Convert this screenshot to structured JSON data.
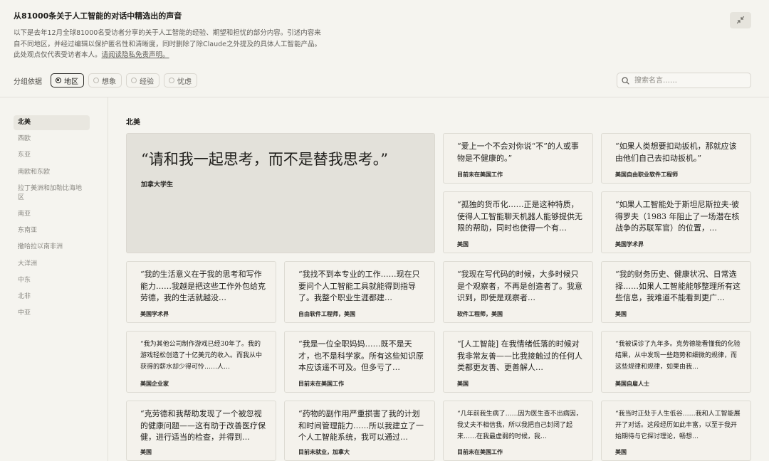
{
  "header": {
    "title": "从81000条关于人工智能的对话中精选出的声音",
    "desc_line1": "以下是去年12月全球81000名受访者分享的关于人工智能的经验、期望和担忧的部分内容。引述内容来",
    "desc_line2": "自不同地区，并经过编辑以保护匿名性和清晰度，同时删除了除Claude之外提及的具体人工智能产品。",
    "desc_line3": "此处观点仅代表受访者本人。",
    "privacy_link": "请阅读隐私免责声明。"
  },
  "grouping": {
    "label": "分组依据",
    "options": [
      "地区",
      "想象",
      "经验",
      "忧虑"
    ],
    "selected": "地区"
  },
  "search": {
    "placeholder": "搜索名言……",
    "value": ""
  },
  "sidebar": {
    "items": [
      "北美",
      "西欧",
      "东亚",
      "南欧和东欧",
      "拉丁美洲和加勒比海地区",
      "南亚",
      "东南亚",
      "撒哈拉以南非洲",
      "大洋洲",
      "中东",
      "北非",
      "中亚"
    ],
    "active": "北美"
  },
  "region_title": "北美",
  "cards": [
    {
      "quote": "“请和我一起思考，而不是替我思考。”",
      "author": "加拿大学生"
    },
    {
      "quote": "“爱上一个不会对你说“不”的人或事物是不健康的。”",
      "author": "目前未在美国工作"
    },
    {
      "quote": "“如果人类想要扣动扳机，那就应该由他们自己去扣动扳机。”",
      "author": "美国自由职业软件工程师"
    },
    {
      "quote": "“孤独的货币化……正是这种特质，使得人工智能聊天机器人能够提供无限的帮助，同时也使得一个有…",
      "author": "美国"
    },
    {
      "quote": "“如果人工智能处于斯坦尼斯拉夫·彼得罗夫（1983 年阻止了一场潜在核战争的苏联军官）的位置，…",
      "author": "美国学术界"
    },
    {
      "quote": "“我的生活意义在于我的思考和写作能力……我越是把这些工作外包给克劳德，我的生活就越没…",
      "author": "美国学术界"
    },
    {
      "quote": "“我找不到本专业的工作……现在只要问个人工智能工具就能得到指导了。我整个职业生涯都建…",
      "author": "自由软件工程师，美国"
    },
    {
      "quote": "“我现在写代码的时候，大多时候只是个观察者，不再是创造者了。我意识到，即使是观察者…",
      "author": "软件工程师，美国"
    },
    {
      "quote": "“我的财务历史、健康状况、日常选择……如果人工智能能够整理所有这些信息，我难道不能看到更广…",
      "author": "美国"
    },
    {
      "quote": "“我为其他公司制作游戏已经30年了。我的游戏轻松创造了十亿美元的收入。而我从中获得的薪水却少得可怜……人…",
      "author": "美国企业家"
    },
    {
      "quote": "“我是一位全职妈妈……既不是天才，也不是科学家。所有这些知识原本应该遥不可及。但多亏了…",
      "author": "目前未在美国工作"
    },
    {
      "quote": "“[人工智能] 在我情绪低落的时候对我非常友善——比我接触过的任何人类都更友善、更善解人…",
      "author": "美国"
    },
    {
      "quote": "“我被误诊了九年多。克劳德能看懂我的化验结果，从中发现一些趋势和细微的规律，而这些规律和规律，如果由我…",
      "author": "美国自雇人士"
    },
    {
      "quote": "“克劳德和我帮助发现了一个被忽视的健康问题——这有助于改善医疗保健，进行适当的检查，并得到…",
      "author": "美国"
    },
    {
      "quote": "“药物的副作用严重损害了我的计划和时间管理能力……所以我建立了一个人工智能系统，我可以通过…",
      "author": "目前未就业，加拿大"
    },
    {
      "quote": "“几年前我生病了……因为医生查不出病因，我丈夫不相信我，所以我把自己封闭了起来……在我最虚弱的时候，我…",
      "author": "目前未在美国工作"
    },
    {
      "quote": "“我当时正处于人生低谷……我和人工智能展开了对话。这段经历如此丰富，以至于我开始期待与它探讨理论，畅想…",
      "author": "美国"
    }
  ]
}
